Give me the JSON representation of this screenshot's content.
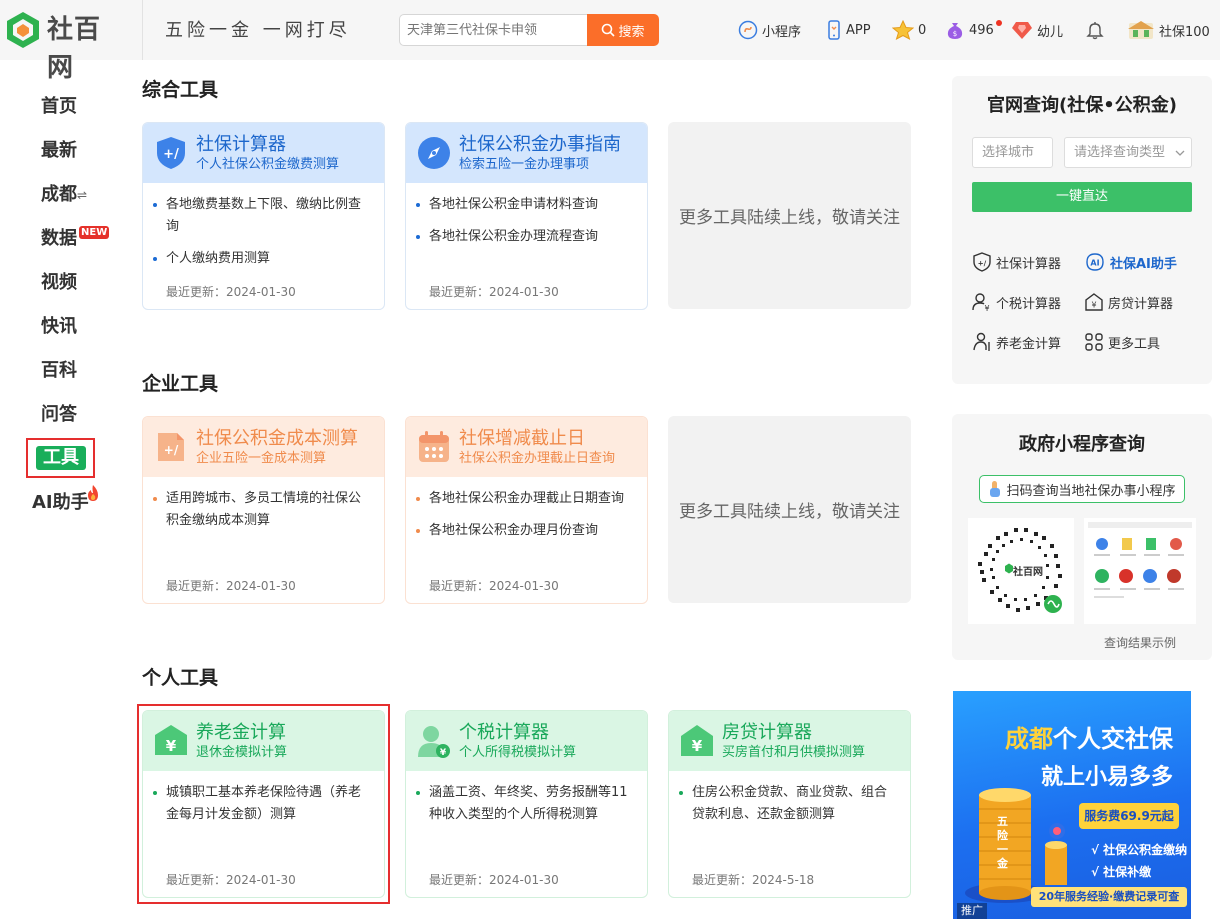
{
  "header": {
    "logo_text": "社百网",
    "slogan": "五险一金  一网打尽",
    "search_placeholder": "天津第三代社保卡申领",
    "search_button": "搜索",
    "links": [
      {
        "label": "小程序",
        "icon": "mini-program-icon"
      },
      {
        "label": "APP",
        "icon": "phone-icon"
      },
      {
        "label": "0",
        "icon": "star-icon"
      },
      {
        "label": "496",
        "icon": "money-bag-icon"
      },
      {
        "label": "幼儿",
        "icon": "diamond-icon"
      },
      {
        "label": "",
        "icon": "bell-icon"
      },
      {
        "label": "社保100",
        "icon": "avatar"
      }
    ]
  },
  "nav": {
    "items": [
      "首页",
      "最新",
      "成都",
      "数据",
      "视频",
      "快讯",
      "百科",
      "问答",
      "工具",
      "AI助手"
    ],
    "city_switch_icon": "⇌",
    "new_badge": "NEW",
    "active": "工具"
  },
  "sections": {
    "comprehensive": {
      "title": "综合工具",
      "cards": [
        {
          "title": "社保计算器",
          "subtitle": "个人社保公积金缴费测算",
          "items": [
            "各地缴费基数上下限、缴纳比例查询",
            "个人缴纳费用测算"
          ],
          "updated": "最近更新：2024-01-30"
        },
        {
          "title": "社保公积金办事指南",
          "subtitle": "检索五险一金办理事项",
          "items": [
            "各地社保公积金申请材料查询",
            "各地社保公积金办理流程查询"
          ],
          "updated": "最近更新：2024-01-30"
        }
      ],
      "more": "更多工具陆续上线，敬请关注"
    },
    "enterprise": {
      "title": "企业工具",
      "cards": [
        {
          "title": "社保公积金成本测算",
          "subtitle": "企业五险一金成本测算",
          "items": [
            "适用跨城市、多员工情境的社保公积金缴纳成本测算"
          ],
          "updated": "最近更新：2024-01-30"
        },
        {
          "title": "社保增减截止日",
          "subtitle": "社保公积金办理截止日查询",
          "items": [
            "各地社保公积金办理截止日期查询",
            "各地社保公积金办理月份查询"
          ],
          "updated": "最近更新：2024-01-30"
        }
      ],
      "more": "更多工具陆续上线，敬请关注"
    },
    "personal": {
      "title": "个人工具",
      "cards": [
        {
          "title": "养老金计算",
          "subtitle": "退休金模拟计算",
          "items": [
            "城镇职工基本养老保险待遇（养老金每月计发金额）测算"
          ],
          "updated": "最近更新：2024-01-30"
        },
        {
          "title": "个税计算器",
          "subtitle": "个人所得税模拟计算",
          "items": [
            "涵盖工资、年终奖、劳务报酬等11种收入类型的个人所得税测算"
          ],
          "updated": "最近更新：2024-01-30"
        },
        {
          "title": "房贷计算器",
          "subtitle": "买房首付和月供模拟测算",
          "items": [
            "住房公积金贷款、商业贷款、组合贷款利息、还款金额测算"
          ],
          "updated": "最近更新：2024-5-18"
        }
      ]
    }
  },
  "right": {
    "query": {
      "title": "官网查询(社保•公积金)",
      "city_placeholder": "选择城市",
      "type_placeholder": "请选择查询类型",
      "button": "一键直达",
      "links": [
        {
          "label": "社保计算器",
          "icon": "shield-calc-icon"
        },
        {
          "label": "社保AI助手",
          "icon": "ai-icon"
        },
        {
          "label": "个税计算器",
          "icon": "person-tax-icon"
        },
        {
          "label": "房贷计算器",
          "icon": "house-icon"
        },
        {
          "label": "养老金计算",
          "icon": "elderly-icon"
        },
        {
          "label": "更多工具",
          "icon": "grid-icon"
        }
      ]
    },
    "gov": {
      "title": "政府小程序查询",
      "scan_text": "扫码查询当地社保办事小程序",
      "qr_label": "社百网",
      "example_caption": "查询结果示例"
    },
    "ad": {
      "line1_city": "成都",
      "line1_rest": "个人交社保",
      "line2": "就上小易多多",
      "price": "服务费69.9元起",
      "bullet1": "√ 社保公积金缴纳",
      "bullet2": "√ 社保补缴",
      "footer": "20年服务经验·缴费记录可查",
      "coin_text": "五险一金",
      "tag": "推广"
    }
  }
}
